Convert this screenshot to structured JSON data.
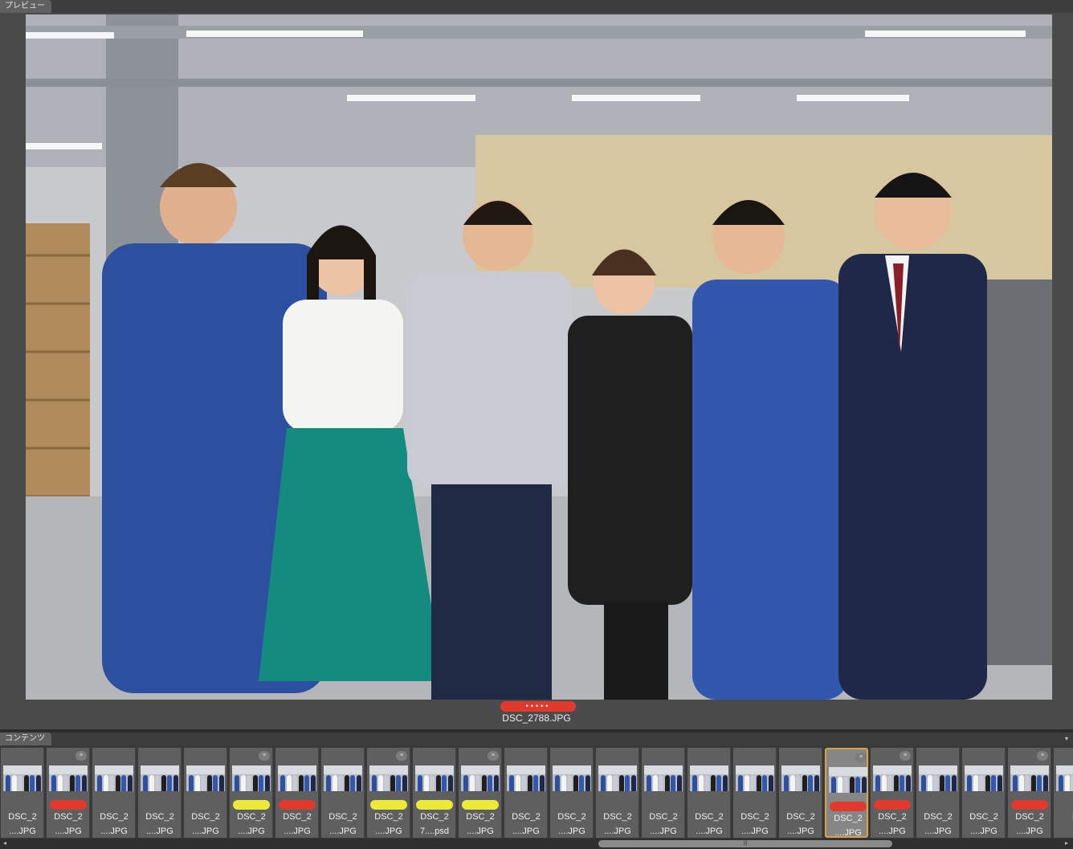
{
  "preview_panel": {
    "tab_label": "プレビュー",
    "filename": "DSC_2788.JPG",
    "label_color": "#e03a2e",
    "rating_dots": "•••••"
  },
  "contents_panel": {
    "tab_label": "コンテンツ"
  },
  "thumbnails": [
    {
      "line1": "DSC_2",
      "line2": "....JPG",
      "label": null,
      "badge": false
    },
    {
      "line1": "DSC_2",
      "line2": "....JPG",
      "label": "#e03a2e",
      "badge": true
    },
    {
      "line1": "DSC_2",
      "line2": "....JPG",
      "label": null,
      "badge": false
    },
    {
      "line1": "DSC_2",
      "line2": "....JPG",
      "label": null,
      "badge": false
    },
    {
      "line1": "DSC_2",
      "line2": "....JPG",
      "label": null,
      "badge": false
    },
    {
      "line1": "DSC_2",
      "line2": "....JPG",
      "label": "#ece93a",
      "badge": true
    },
    {
      "line1": "DSC_2",
      "line2": "....JPG",
      "label": "#e03a2e",
      "badge": false
    },
    {
      "line1": "DSC_2",
      "line2": "....JPG",
      "label": null,
      "badge": false
    },
    {
      "line1": "DSC_2",
      "line2": "....JPG",
      "label": "#ece93a",
      "badge": true
    },
    {
      "line1": "DSC_2",
      "line2": "7....psd",
      "label": "#ece93a",
      "badge": false
    },
    {
      "line1": "DSC_2",
      "line2": "....JPG",
      "label": "#ece93a",
      "badge": true
    },
    {
      "line1": "DSC_2",
      "line2": "....JPG",
      "label": null,
      "badge": false
    },
    {
      "line1": "DSC_2",
      "line2": "....JPG",
      "label": null,
      "badge": false
    },
    {
      "line1": "DSC_2",
      "line2": "....JPG",
      "label": null,
      "badge": false
    },
    {
      "line1": "DSC_2",
      "line2": "....JPG",
      "label": null,
      "badge": false
    },
    {
      "line1": "DSC_2",
      "line2": "....JPG",
      "label": null,
      "badge": false
    },
    {
      "line1": "DSC_2",
      "line2": "....JPG",
      "label": null,
      "badge": false
    },
    {
      "line1": "DSC_2",
      "line2": "....JPG",
      "label": null,
      "badge": false
    },
    {
      "line1": "DSC_2",
      "line2": "....JPG",
      "label": "#e03a2e",
      "badge": true,
      "selected": true
    },
    {
      "line1": "DSC_2",
      "line2": "....JPG",
      "label": "#e03a2e",
      "badge": true
    },
    {
      "line1": "DSC_2",
      "line2": "....JPG",
      "label": null,
      "badge": false
    },
    {
      "line1": "DSC_2",
      "line2": "....JPG",
      "label": null,
      "badge": false
    },
    {
      "line1": "DSC_2",
      "line2": "....JPG",
      "label": "#e03a2e",
      "badge": true
    },
    {
      "line1": "D",
      "line2": "",
      "label": null,
      "badge": false
    }
  ],
  "scrollbar": {
    "thumb_grip": "|||"
  }
}
